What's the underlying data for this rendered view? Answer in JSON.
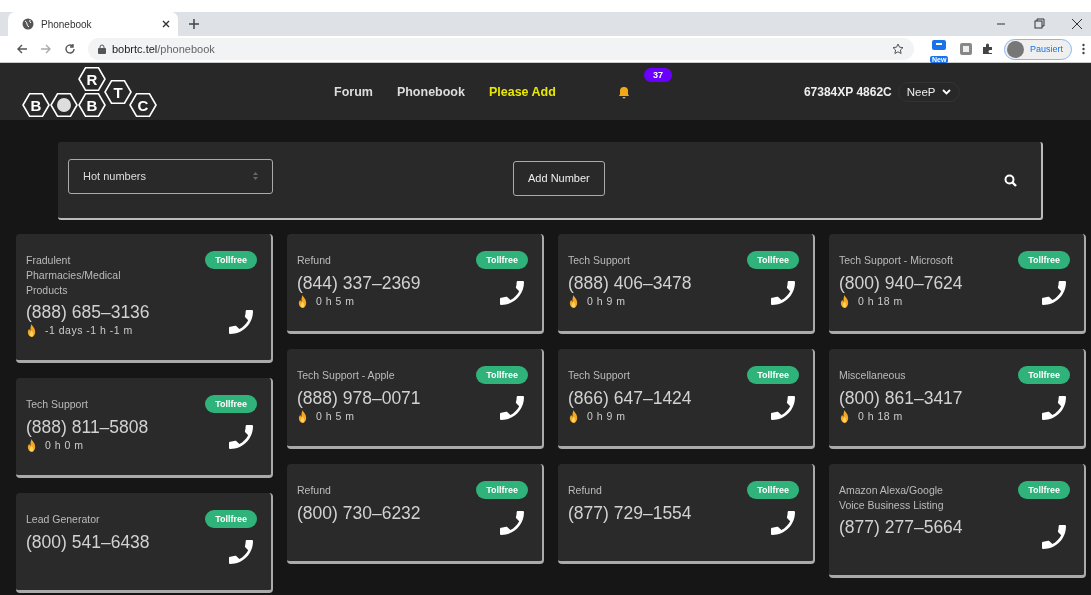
{
  "browser": {
    "tab_title": "Phonebook",
    "url_host": "bobrtc.tel",
    "url_path": "/phonebook",
    "extension_badge": "New",
    "profile_status": "Pausiert"
  },
  "nav": {
    "logo_letters": [
      "B",
      "B",
      "R",
      "T",
      "C"
    ],
    "links": [
      {
        "label": "Forum",
        "highlighted": false
      },
      {
        "label": "Phonebook",
        "highlighted": false
      },
      {
        "label": "Please Add",
        "highlighted": true
      }
    ],
    "notification_count": "37",
    "user_code": "67384XP 4862C",
    "user_menu": "NeeP"
  },
  "toolbar": {
    "filter": "Hot numbers",
    "add_button": "Add Number"
  },
  "columns": [
    {
      "cards": [
        {
          "category": "Fradulent Pharmacies/Medical Products",
          "phone": "(888) 685–3136",
          "badge": "Tollfree",
          "age": "-1 days -1 h -1 m"
        },
        {
          "category": "Tech Support",
          "phone": "(888) 811–5808",
          "badge": "Tollfree",
          "age": "0 h 0 m"
        },
        {
          "category": "Lead Generator",
          "phone": "(800) 541–6438",
          "badge": "Tollfree"
        }
      ]
    },
    {
      "cards": [
        {
          "category": "Refund",
          "phone": "(844) 337–2369",
          "badge": "Tollfree",
          "age": "0 h 5 m"
        },
        {
          "category": "Tech Support - Apple",
          "phone": "(888) 978–0071",
          "badge": "Tollfree",
          "age": "0 h 5 m"
        },
        {
          "category": "Refund",
          "phone": "(800) 730–6232",
          "badge": "Tollfree"
        }
      ]
    },
    {
      "cards": [
        {
          "category": "Tech Support",
          "phone": "(888) 406–3478",
          "badge": "Tollfree",
          "age": "0 h 9 m"
        },
        {
          "category": "Tech Support",
          "phone": "(866) 647–1424",
          "badge": "Tollfree",
          "age": "0 h 9 m"
        },
        {
          "category": "Refund",
          "phone": "(877) 729–1554",
          "badge": "Tollfree"
        }
      ]
    },
    {
      "cards": [
        {
          "category": "Tech Support - Microsoft",
          "phone": "(800) 940–7624",
          "badge": "Tollfree",
          "age": "0 h 18 m"
        },
        {
          "category": "Miscellaneous",
          "phone": "(800) 861–3417",
          "badge": "Tollfree",
          "age": "0 h 18 m"
        },
        {
          "category": "Amazon Alexa/Google Voice Business Listing",
          "phone": "(877) 277–5664",
          "badge": "Tollfree"
        }
      ]
    }
  ]
}
